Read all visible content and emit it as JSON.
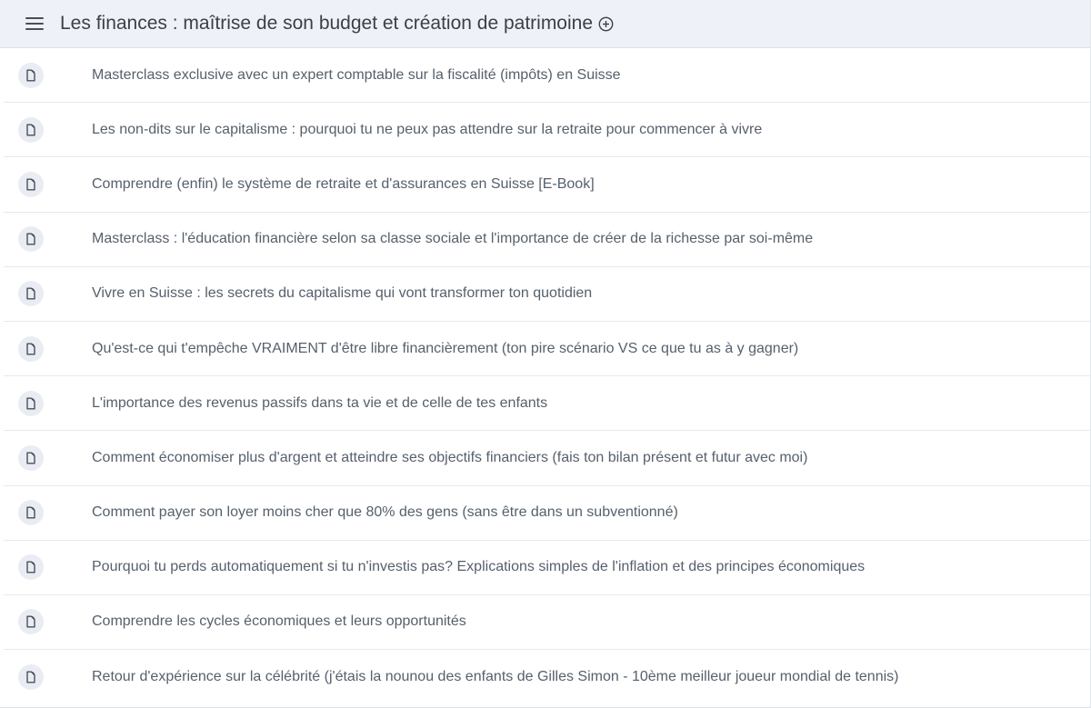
{
  "section": {
    "title": "Les finances : maîtrise de son budget et création de patrimoine",
    "menu_icon": "hamburger-menu-icon",
    "add_icon": "plus-circle-icon"
  },
  "lessons": [
    {
      "label": "Masterclass exclusive avec un expert comptable sur la fiscalité (impôts) en Suisse",
      "icon": "document-icon"
    },
    {
      "label": "Les non-dits sur le capitalisme : pourquoi tu ne peux pas attendre sur la retraite pour commencer à vivre",
      "icon": "document-icon"
    },
    {
      "label": "Comprendre (enfin) le système de retraite et d'assurances en Suisse [E-Book]",
      "icon": "document-icon"
    },
    {
      "label": "Masterclass : l'éducation financière selon sa classe sociale et l'importance de créer de la richesse par soi-même",
      "icon": "document-icon"
    },
    {
      "label": "Vivre en Suisse : les secrets du capitalisme qui vont transformer ton quotidien",
      "icon": "document-icon"
    },
    {
      "label": "Qu'est-ce qui t'empêche VRAIMENT d'être libre financièrement (ton pire scénario VS ce que tu as à y gagner)",
      "icon": "document-icon"
    },
    {
      "label": "L'importance des revenus passifs dans ta vie et de celle de tes enfants",
      "icon": "document-icon"
    },
    {
      "label": "Comment économiser plus d'argent et atteindre ses objectifs financiers (fais ton bilan présent et futur avec moi)",
      "icon": "document-icon"
    },
    {
      "label": "Comment payer son loyer moins cher que 80% des gens (sans être dans un subventionné)",
      "icon": "document-icon"
    },
    {
      "label": "Pourquoi tu perds automatiquement si tu n'investis pas? Explications simples de l'inflation et des principes économiques",
      "icon": "document-icon"
    },
    {
      "label": "Comprendre les cycles économiques et leurs opportunités",
      "icon": "document-icon"
    },
    {
      "label": "Retour d'expérience sur la célébrité (j'étais la nounou des enfants de Gilles Simon - 10ème meilleur joueur mondial de tennis)",
      "icon": "document-icon"
    }
  ],
  "colors": {
    "header_bg": "#eef2f8",
    "text": "#56606c",
    "title": "#3b3f46",
    "badge_bg": "#e9edf3"
  }
}
